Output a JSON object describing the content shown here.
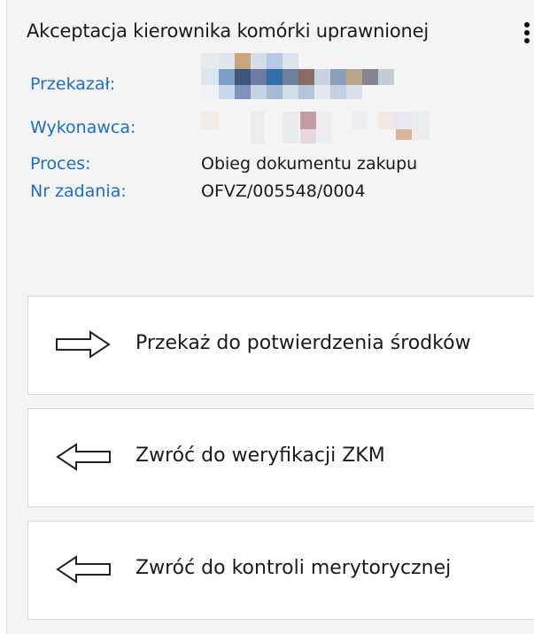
{
  "task": {
    "title": "Akceptacja kierownika komórki uprawnionej",
    "fields": {
      "przekazal_label": "Przekazał:",
      "wykonawca_label": "Wykonawca:",
      "proces_label": "Proces:",
      "proces_value": "Obieg dokumentu zakupu",
      "nr_zadania_label": "Nr zadania:",
      "nr_zadania_value": "OFVZ/005548/0004"
    }
  },
  "actions": [
    {
      "label": "Przekaż do potwierdzenia środków",
      "icon": "arrow-right-icon"
    },
    {
      "label": "Zwróć do weryfikacji ZKM",
      "icon": "arrow-left-icon"
    },
    {
      "label": "Zwróć do kontroli merytorycznej",
      "icon": "arrow-left-icon"
    }
  ],
  "colors": {
    "label": "#1c6fc5",
    "panel_bg": "#f4f4f4",
    "button_bg": "#ffffff"
  }
}
